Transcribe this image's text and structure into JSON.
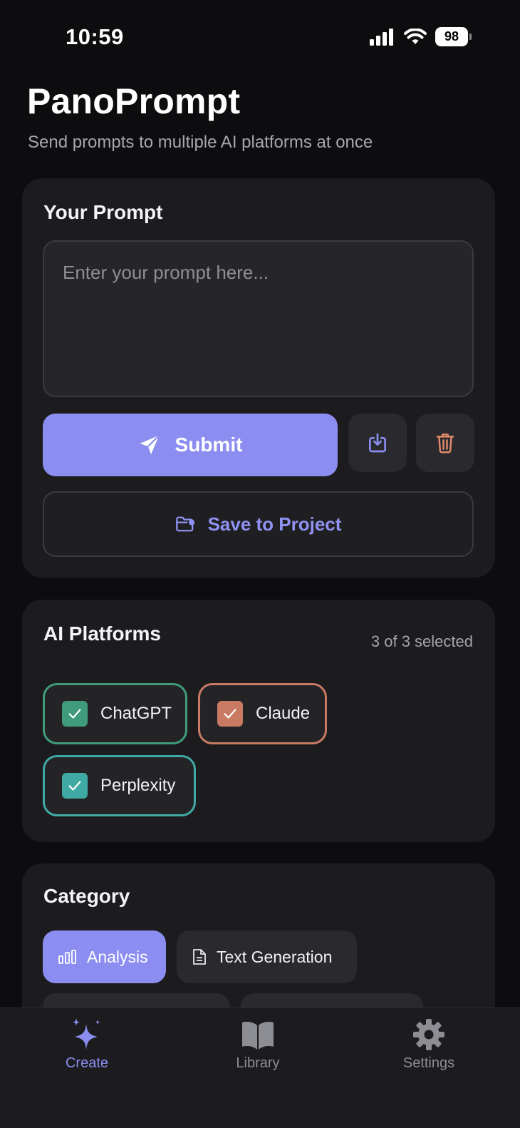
{
  "status_bar": {
    "time": "10:59",
    "battery": "98"
  },
  "header": {
    "title": "PanoPrompt",
    "subtitle": "Send prompts to multiple AI platforms at once"
  },
  "prompt": {
    "title": "Your Prompt",
    "placeholder": "Enter your prompt here...",
    "value": "",
    "submit_label": "Submit",
    "save_to_project_label": "Save to Project",
    "colors": {
      "accent": "#8b8ef0",
      "delete": "#e08a6b"
    }
  },
  "platforms": {
    "title": "AI Platforms",
    "selected_count": "3 of 3 selected",
    "items": [
      {
        "label": "ChatGPT",
        "checked": true,
        "color": "#3f9b7c"
      },
      {
        "label": "Claude",
        "checked": true,
        "color": "#c97a62"
      },
      {
        "label": "Perplexity",
        "checked": true,
        "color": "#3fa9a3"
      }
    ]
  },
  "category": {
    "title": "Category",
    "items": [
      {
        "label": "Analysis",
        "icon": "bar-chart-icon",
        "active": true
      },
      {
        "label": "Text Generation",
        "icon": "document-icon",
        "active": false
      }
    ]
  },
  "tab_bar": {
    "tabs": [
      {
        "label": "Create",
        "icon": "sparkles-icon",
        "active": true
      },
      {
        "label": "Library",
        "icon": "book-icon",
        "active": false
      },
      {
        "label": "Settings",
        "icon": "gear-icon",
        "active": false
      }
    ]
  }
}
